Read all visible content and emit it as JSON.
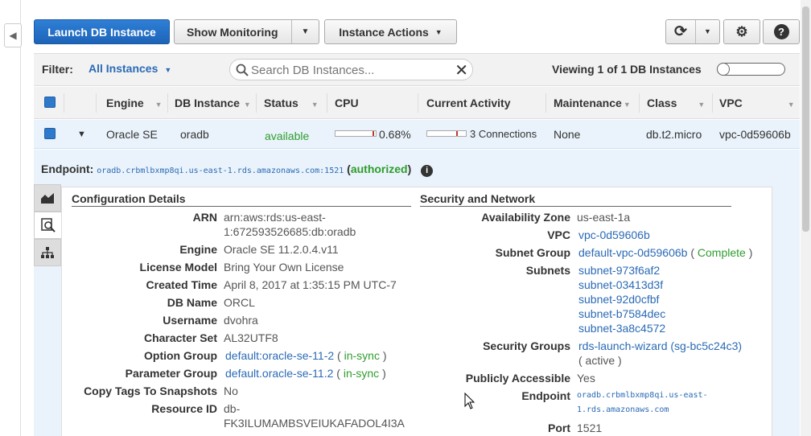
{
  "toolbar": {
    "launch": "Launch DB Instance",
    "monitoring": "Show Monitoring",
    "actions": "Instance Actions"
  },
  "filter": {
    "label": "Filter:",
    "value": "All Instances",
    "search_placeholder": "Search DB Instances...",
    "viewing": "Viewing 1 of 1 DB Instances"
  },
  "columns": [
    "Engine",
    "DB Instance",
    "Status",
    "CPU",
    "Current Activity",
    "Maintenance",
    "Class",
    "VPC"
  ],
  "instance": {
    "engine": "Oracle SE",
    "name": "oradb",
    "status": "available",
    "cpu": "0.68%",
    "cpu_fraction": 0.0068,
    "activity": "3 Connections",
    "maintenance": "None",
    "class": "db.t2.micro",
    "vpc": "vpc-0d59606b"
  },
  "endpoint": {
    "label": "Endpoint:",
    "value": "oradb.crbmlbxmp8qi.us-east-1.rds.amazonaws.com:1521",
    "paren_open": "(",
    "status": "authorized",
    "paren_close": ")"
  },
  "config": {
    "title": "Configuration Details",
    "arn_k": "ARN",
    "arn_v1": "arn:aws:rds:us-east-",
    "arn_v2": "1:672593526685:db:oradb",
    "engine_k": "Engine",
    "engine_v": "Oracle SE 11.2.0.4.v11",
    "license_k": "License Model",
    "license_v": "Bring Your Own License",
    "created_k": "Created Time",
    "created_v": "April 8, 2017 at 1:35:15 PM UTC-7",
    "dbname_k": "DB Name",
    "dbname_v": "ORCL",
    "user_k": "Username",
    "user_v": "dvohra",
    "charset_k": "Character Set",
    "charset_v": "AL32UTF8",
    "optgroup_k": "Option Group",
    "optgroup_v": "default:oracle-se-11-2",
    "optgroup_s": "in-sync",
    "pgroup_k": "Parameter Group",
    "pgroup_v": "default.oracle-se-11.2",
    "pgroup_s": "in-sync",
    "copytags_k": "Copy Tags To Snapshots",
    "copytags_v": "No",
    "resid_k": "Resource ID",
    "resid_v1": "db-",
    "resid_v2": "FK3ILUMAMBSVEIUKAFADOL4I3A"
  },
  "security": {
    "title": "Security and Network",
    "az_k": "Availability Zone",
    "az_v": "us-east-1a",
    "vpc_k": "VPC",
    "vpc_v": "vpc-0d59606b",
    "subnetg_k": "Subnet Group",
    "subnetg_v": "default-vpc-0d59606b",
    "subnetg_s": "Complete",
    "subnets_k": "Subnets",
    "subnets": [
      "subnet-973f6af2",
      "subnet-03413d3f",
      "subnet-92d0cfbf",
      "subnet-b7584dec",
      "subnet-3a8c4572"
    ],
    "sg_k": "Security Groups",
    "sg_v": "rds-launch-wizard (sg-bc5c24c3)",
    "sg_s": "( active )",
    "public_k": "Publicly Accessible",
    "public_v": "Yes",
    "ep_k": "Endpoint",
    "ep_v1": "oradb.crbmlbxmp8qi.us-east-",
    "ep_v2": "1.rds.amazonaws.com",
    "port_k": "Port",
    "port_v": "1521"
  },
  "colors": {
    "primary": "#1d64b8",
    "link": "#2a6ab5",
    "ok": "#2e9d2e",
    "row": "#eaf3fb"
  }
}
